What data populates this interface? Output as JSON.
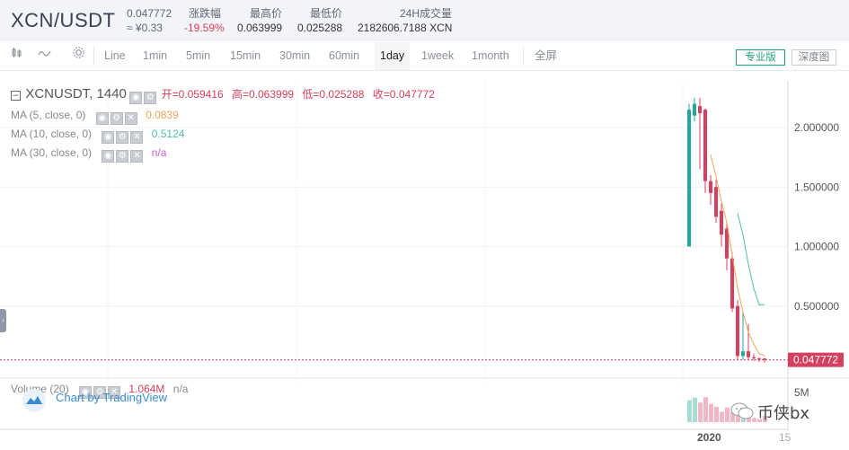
{
  "header": {
    "pair": "XCN/USDT",
    "last_price": "0.047772",
    "cny_price": "≈ ¥0.33",
    "change_label": "涨跌幅",
    "change_value": "-19.59%",
    "high_label": "最高价",
    "high_value": "0.063999",
    "low_label": "最低价",
    "low_value": "0.025288",
    "volume_label": "24H成交量",
    "volume_value": "2182606.7188 XCN"
  },
  "toolbar": {
    "intervals": [
      "Line",
      "1min",
      "5min",
      "15min",
      "30min",
      "60min",
      "1day",
      "1week",
      "1month"
    ],
    "active_interval": "1day",
    "fullscreen_label": "全屏",
    "pro_label": "专业版",
    "depth_label": "深度图"
  },
  "legend": {
    "symbol": "XCNUSDT, 1440",
    "open": "开=0.059416",
    "high": "高=0.063999",
    "low": "低=0.025288",
    "close": "收=0.047772",
    "ma5_label": "MA (5, close, 0)",
    "ma5_value": "0.0839",
    "ma10_label": "MA (10, close, 0)",
    "ma10_value": "0.5124",
    "ma30_label": "MA (30, close, 0)",
    "ma30_value": "n/a",
    "volume_label": "Volume (20)",
    "volume_value": "1.064M",
    "volume_ma": "n/a"
  },
  "axis": {
    "price_ticks": [
      "2.000000",
      "1.500000",
      "1.000000",
      "0.500000"
    ],
    "current_price_tag": "0.047772",
    "volume_tick": "5M",
    "time_labels": [
      "2020",
      "15"
    ]
  },
  "branding": {
    "tradingview": "Chart by TradingView",
    "watermark": "币侠bx"
  },
  "colors": {
    "up": "#26a69a",
    "down": "#d5405e",
    "ma5": "#f0a559",
    "ma10": "#4fc1a9",
    "ma30": "#c75fd0"
  },
  "chart_data": {
    "type": "candlestick",
    "symbol": "XCNUSDT",
    "interval": "1440",
    "ylim": [
      0,
      2.4
    ],
    "candles": [
      {
        "o": 1.0,
        "h": 2.2,
        "l": 1.0,
        "c": 2.15
      },
      {
        "o": 2.1,
        "h": 2.25,
        "l": 2.05,
        "c": 2.2
      },
      {
        "o": 2.18,
        "h": 2.25,
        "l": 1.65,
        "c": 2.12
      },
      {
        "o": 2.15,
        "h": 2.16,
        "l": 1.45,
        "c": 1.55
      },
      {
        "o": 1.55,
        "h": 1.6,
        "l": 1.35,
        "c": 1.45
      },
      {
        "o": 1.5,
        "h": 1.56,
        "l": 1.2,
        "c": 1.25
      },
      {
        "o": 1.3,
        "h": 1.36,
        "l": 1.0,
        "c": 1.1
      },
      {
        "o": 1.15,
        "h": 1.2,
        "l": 0.8,
        "c": 0.9
      },
      {
        "o": 0.9,
        "h": 0.95,
        "l": 0.45,
        "c": 0.48
      },
      {
        "o": 0.5,
        "h": 0.55,
        "l": 0.05,
        "c": 0.08
      },
      {
        "o": 0.08,
        "h": 0.45,
        "l": 0.05,
        "c": 0.12
      },
      {
        "o": 0.12,
        "h": 0.35,
        "l": 0.05,
        "c": 0.07
      },
      {
        "o": 0.07,
        "h": 0.1,
        "l": 0.04,
        "c": 0.06
      },
      {
        "o": 0.06,
        "h": 0.07,
        "l": 0.03,
        "c": 0.05
      },
      {
        "o": 0.059416,
        "h": 0.063999,
        "l": 0.025288,
        "c": 0.047772
      }
    ],
    "ma5": [
      null,
      null,
      null,
      null,
      1.77,
      1.59,
      1.38,
      1.2,
      0.93,
      0.65,
      0.45,
      0.28,
      0.18,
      0.1,
      0.0839
    ],
    "ma10": [
      null,
      null,
      null,
      null,
      null,
      null,
      null,
      null,
      null,
      1.28,
      1.1,
      0.85,
      0.65,
      0.51,
      0.5124
    ],
    "volume": [
      3.6,
      4.0,
      3.2,
      4.1,
      3.0,
      2.5,
      1.7,
      2.4,
      1.6,
      1.3,
      0.9,
      1.0,
      0.7,
      0.5,
      1.064
    ]
  }
}
